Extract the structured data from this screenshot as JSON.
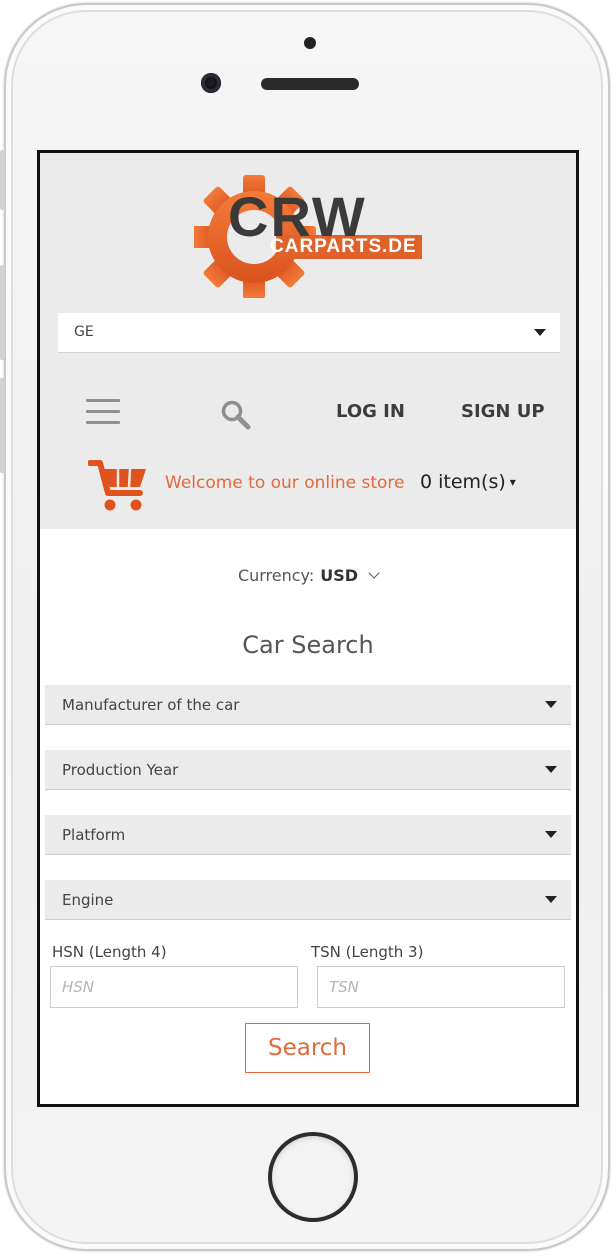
{
  "logo": {
    "brand": "CRW",
    "sub": "CARPARTS",
    "tld": ".DE"
  },
  "language_select": {
    "value": "GE"
  },
  "nav": {
    "login_label": "LOG IN",
    "signup_label": "SIGN UP"
  },
  "cart": {
    "welcome": "Welcome to our online store",
    "items": "0 item(s)",
    "dropdown_glyph": "▾"
  },
  "currency": {
    "label": "Currency:",
    "value": "USD"
  },
  "car_search": {
    "title": "Car Search",
    "manufacturer": "Manufacturer of the car",
    "production_year": "Production Year",
    "platform": "Platform",
    "engine": "Engine",
    "hsn_label": "HSN (Length 4)",
    "hsn_placeholder": "HSN",
    "tsn_label": "TSN (Length 3)",
    "tsn_placeholder": "TSN",
    "search_label": "Search"
  },
  "icons": {
    "menu": "hamburger-menu-icon",
    "search": "magnifier-icon",
    "cart": "shopping-cart-icon",
    "dropdown": "caret-down-icon",
    "currency_chevron": "chevron-down-icon"
  },
  "colors": {
    "accent": "#e36a3a",
    "header_bg": "#ebebeb",
    "text_dark": "#3d3d3d"
  }
}
